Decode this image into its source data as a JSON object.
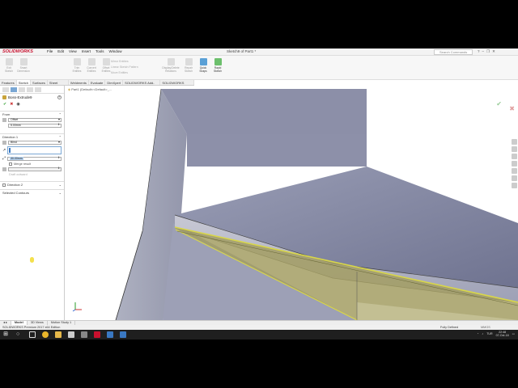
{
  "app": {
    "logo_text": "SOLIDWORKS",
    "document_title": "Sketch9 of Part1 *",
    "search_placeholder": "Search Commands",
    "menu": [
      "File",
      "Edit",
      "View",
      "Insert",
      "Tools",
      "Window"
    ]
  },
  "ribbon": {
    "buttons": [
      {
        "label": "Exit Sketch",
        "active": false
      },
      {
        "label": "Smart Dimension",
        "active": false
      },
      {
        "label": "Trim Entities",
        "active": false
      },
      {
        "label": "Convert Entities",
        "active": false
      },
      {
        "label": "Offset Entities",
        "active": false
      }
    ],
    "small": [
      "Mirror Entities",
      "Linear Sketch Pattern",
      "Move Entities"
    ],
    "right_buttons": [
      {
        "label": "Display/Delete Relations",
        "active": false
      },
      {
        "label": "Repair Sketch",
        "active": false
      },
      {
        "label": "Quick Snaps",
        "active": true
      },
      {
        "label": "Rapid Sketch",
        "active": true
      }
    ]
  },
  "command_tabs": [
    "Features",
    "Sketch",
    "Surfaces",
    "Sheet Metal",
    "Weldments",
    "Evaluate",
    "DimXpert",
    "SOLIDWORKS Add-Ins",
    "SOLIDWORKS MBD"
  ],
  "property_manager": {
    "title": "Boss-Extrude9",
    "from": {
      "header": "From",
      "start_condition": "Offset",
      "offset_value": "5.00mm"
    },
    "direction1": {
      "header": "Direction 1",
      "end_condition": "Blind",
      "depth_value": "30.00mm",
      "merge_result": "Merge result",
      "draft_outward": "Draft outward"
    },
    "direction2": "Direction 2",
    "selected_contours": "Selected Contours"
  },
  "viewport": {
    "tree_label": "Part1 (Default<<Default>_...",
    "extrude_fill": "#a39e63",
    "extrude_edge": "#d8d64a",
    "body_color": "#8a8fa8"
  },
  "bottom_tabs": [
    "Model",
    "3D Views",
    "Motion Study 1"
  ],
  "status": {
    "left": "SOLIDWORKS Premium 2017 x64 Edition",
    "center": "Fully Defined",
    "right": "MMGS"
  },
  "taskbar": {
    "icons": [
      "search-icon",
      "task-view-icon",
      "chrome-icon",
      "file-explorer-icon",
      "store-icon",
      "camera-icon",
      "solidworks-icon",
      "app-icon",
      "app2-icon"
    ],
    "lang": "TUR",
    "time": "22:48",
    "date": "07-Oct-18"
  }
}
